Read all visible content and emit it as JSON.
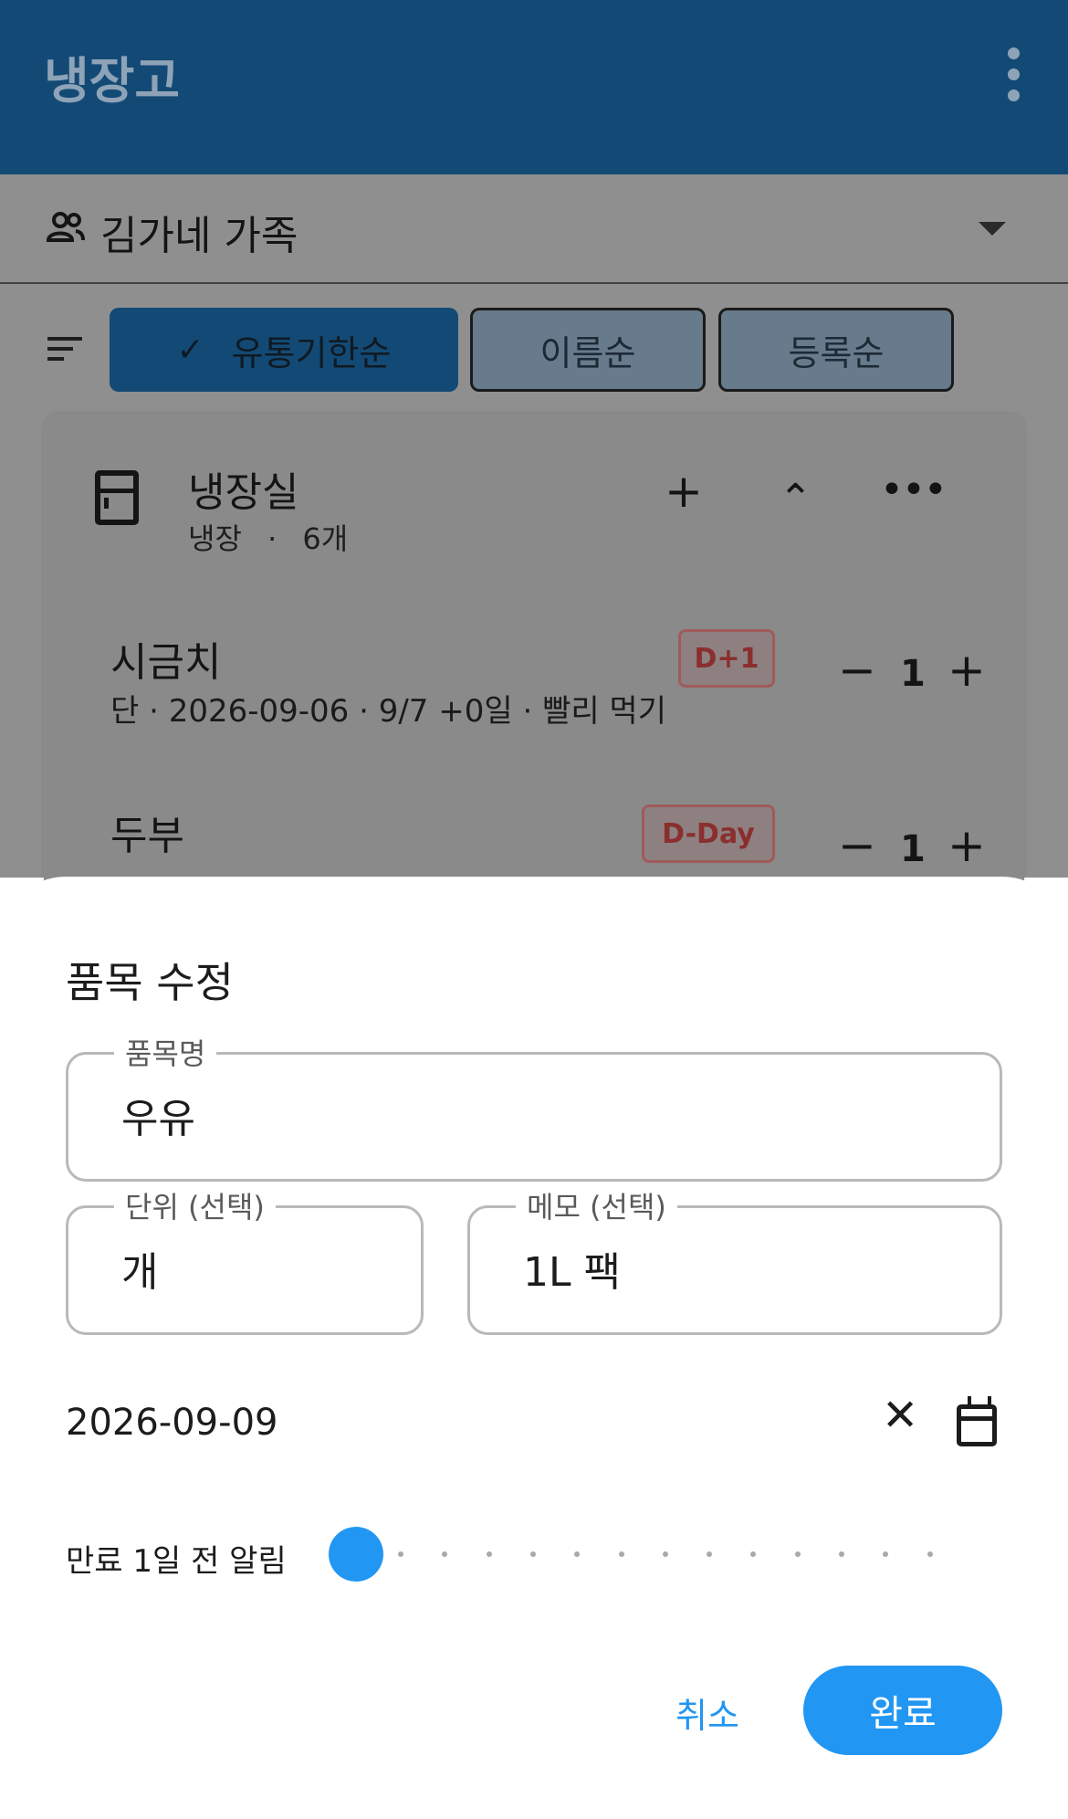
{
  "appbar": {
    "title": "냉장고"
  },
  "family": {
    "name": "김가네 가족"
  },
  "sort": {
    "chips": [
      {
        "label": "유통기한순",
        "selected": true
      },
      {
        "label": "이름순",
        "selected": false
      },
      {
        "label": "등록순",
        "selected": false
      }
    ]
  },
  "section": {
    "title": "냉장실",
    "storage": "냉장",
    "dot": "·",
    "count": "6개"
  },
  "items": [
    {
      "name": "시금치",
      "badge": "D+1",
      "detail": "단 · 2026-09-06 · 9/7 +0일 · 빨리 먹기",
      "qty": "1"
    },
    {
      "name": "두부",
      "badge": "D-Day",
      "detail": "",
      "qty": "1"
    }
  ],
  "dialog": {
    "title": "품목 수정",
    "name_label": "품목명",
    "name_value": "우유",
    "unit_label": "단위 (선택)",
    "unit_value": "개",
    "memo_label": "메모 (선택)",
    "memo_value": "1L 팩",
    "expiry_date": "2026-09-09",
    "alarm_label": "만료 1일 전 알림",
    "alarm_days": 1,
    "cancel_label": "취소",
    "done_label": "완료"
  },
  "icons": {
    "more": "more-vert-icon",
    "family": "people-icon",
    "dropdown": "arrow-drop-down-icon",
    "sort": "sort-icon",
    "check": "check-icon",
    "fridge": "fridge-icon",
    "clear": "close-icon",
    "calendar": "calendar-icon"
  },
  "colors": {
    "appbar": "#134a75",
    "accent": "#2196f3",
    "badge": "#8b2e2e"
  }
}
